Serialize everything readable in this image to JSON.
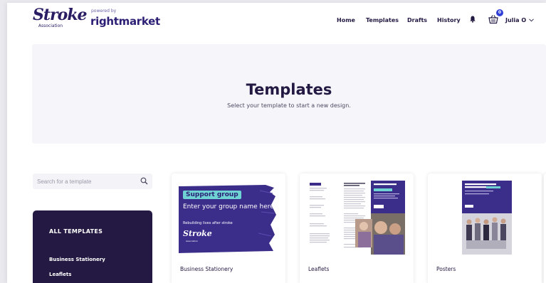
{
  "brand": {
    "logo_name": "Stroke",
    "logo_sub": "Association",
    "powered_by": "powered by",
    "partner_logo": "rightmarket"
  },
  "nav": {
    "items": [
      "Home",
      "Templates",
      "Drafts",
      "History"
    ],
    "bell_icon": "bell-icon",
    "basket_icon": "basket-icon",
    "basket_count": "0",
    "user_label": "Julia O",
    "user_chevron": "chevron-down-icon"
  },
  "hero": {
    "title": "Templates",
    "subtitle": "Select your template to start a new design."
  },
  "search": {
    "placeholder": "Search for a template",
    "icon": "search-icon"
  },
  "categories": {
    "title": "ALL TEMPLATES",
    "items": [
      "Business Stationery",
      "Leaflets"
    ]
  },
  "cards": [
    {
      "label": "Business Stationery",
      "thumb": {
        "pill": "Support group",
        "heading": "Enter your group name here",
        "tagline": "Rebuilding lives after stroke",
        "logo": "Stroke",
        "logo_sub": "Association"
      }
    },
    {
      "label": "Leaflets"
    },
    {
      "label": "Posters"
    }
  ],
  "colors": {
    "brand_navy": "#231942",
    "brand_purple": "#3b2d8a",
    "accent_teal": "#6fd3d3",
    "badge_blue": "#2f3fd6"
  }
}
